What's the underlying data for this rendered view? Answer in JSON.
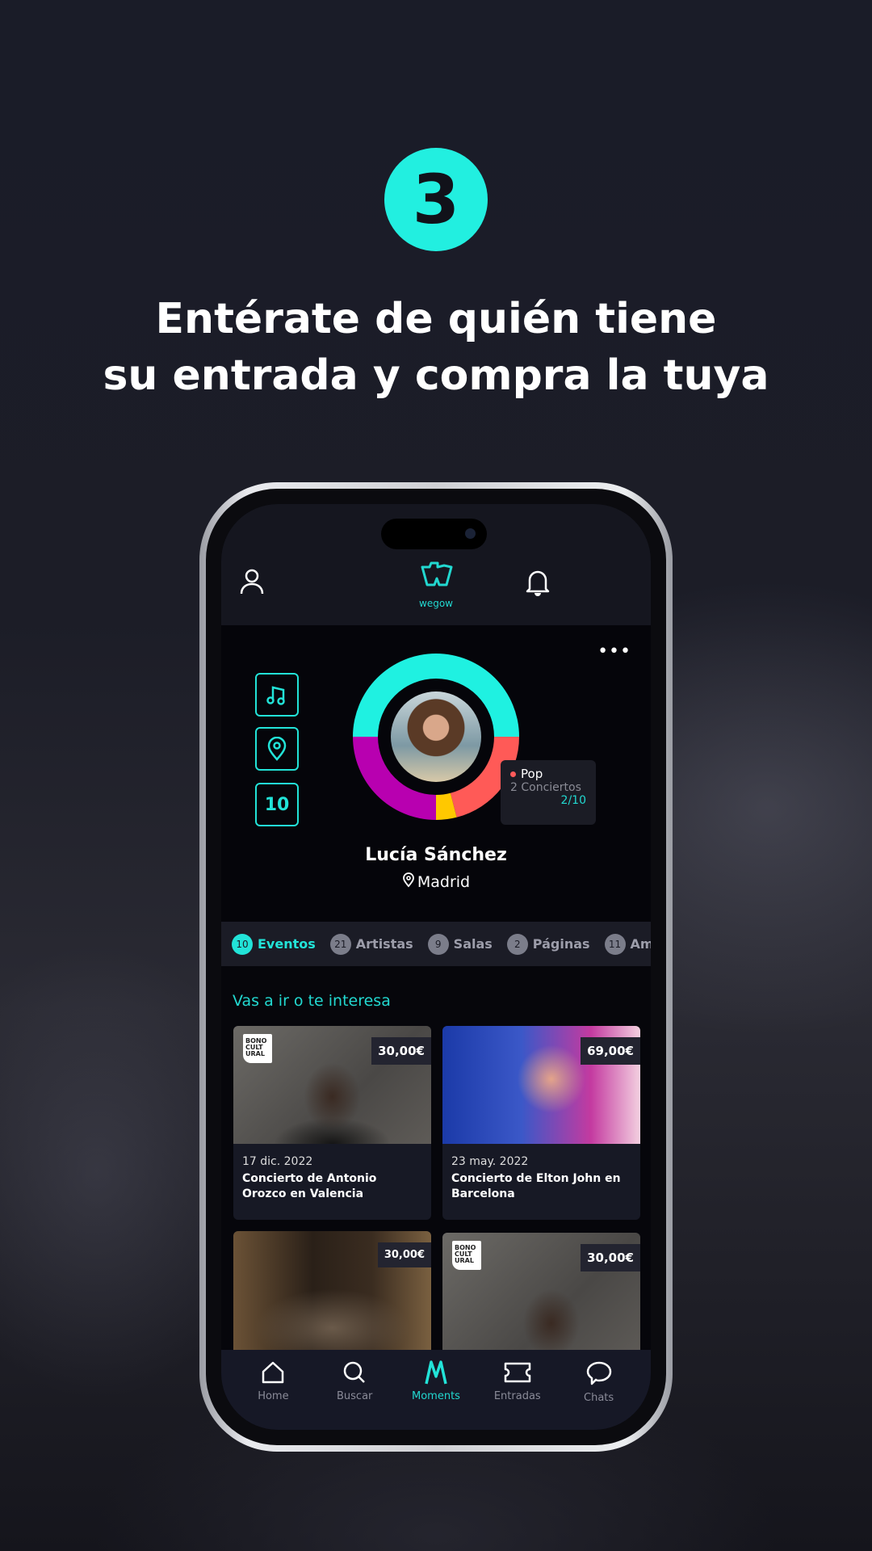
{
  "promo": {
    "step": "3",
    "headline_line1": "Entérate de quién tiene",
    "headline_line2": "su entrada y compra la tuya"
  },
  "colors": {
    "accent": "#22e3d8"
  },
  "header": {
    "logo_text": "wegow",
    "icons": [
      "user-icon",
      "wegow-logo",
      "bell-icon"
    ]
  },
  "profile": {
    "name": "Lucía Sánchez",
    "city": "Madrid",
    "stat_box": "10",
    "genre_ring": [
      {
        "color": "#1ff1e1",
        "fraction": 0.5
      },
      {
        "color": "#ff5a57",
        "fraction": 0.21
      },
      {
        "color": "#ffc800",
        "fraction": 0.04
      },
      {
        "color": "#b800b0",
        "fraction": 0.25
      }
    ],
    "tooltip": {
      "genre": "Pop",
      "concerts": "2 Conciertos",
      "ratio": "2/10"
    }
  },
  "tabs": [
    {
      "count": "10",
      "label": "Eventos",
      "active": true
    },
    {
      "count": "21",
      "label": "Artistas"
    },
    {
      "count": "9",
      "label": "Salas"
    },
    {
      "count": "2",
      "label": "Páginas"
    },
    {
      "count": "11",
      "label": "Amigos"
    }
  ],
  "section_title": "Vas a ir o te interesa",
  "events": [
    {
      "price": "30,00€",
      "date": "17 dic. 2022",
      "title": "Concierto de Antonio Orozco en Valencia",
      "bono": "BONO CULT URAL"
    },
    {
      "price": "69,00€",
      "date": "23 may. 2022",
      "title": "Concierto de Elton John en Barcelona"
    },
    {
      "price": "30,00€"
    },
    {
      "price": "30,00€",
      "bono": "BONO CULT URAL"
    }
  ],
  "nav": [
    {
      "label": "Home"
    },
    {
      "label": "Buscar"
    },
    {
      "label": "Moments",
      "active": true
    },
    {
      "label": "Entradas"
    },
    {
      "label": "Chats"
    }
  ]
}
